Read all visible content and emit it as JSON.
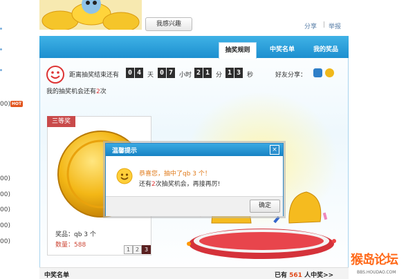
{
  "left_column": {
    "values": [
      "00)",
      "00)",
      "00)",
      "00)",
      "00)",
      "00)"
    ],
    "hot_badge": "HOT"
  },
  "top": {
    "interest_button": "我感兴趣",
    "share_link": "分享",
    "separator": "|",
    "report_link": "举报"
  },
  "tabs": [
    {
      "label": "抽奖规则"
    },
    {
      "label": "中奖名单"
    },
    {
      "label": "我的奖品"
    }
  ],
  "countdown": {
    "prefix": "距离抽奖结束还有",
    "days": [
      "0",
      "4"
    ],
    "day_unit": "天",
    "hours": [
      "0",
      "7"
    ],
    "hour_unit": "小时",
    "minutes": [
      "2",
      "1"
    ],
    "minute_unit": "分",
    "seconds": [
      "1",
      "3"
    ],
    "second_unit": "秒"
  },
  "friend_share_label": "好友分享：",
  "chances": {
    "prefix": "我的抽奖机会还有",
    "count": "2",
    "suffix": "次"
  },
  "prize_card": {
    "tag": "三等奖",
    "name": "奖品：qb 3 个",
    "quantity": "数量：588",
    "pages": [
      "1",
      "2",
      "3"
    ],
    "current_page": "3"
  },
  "dialog": {
    "title": "温馨提示",
    "close": "×",
    "message1": "恭喜您，抽中了qb 3 个！",
    "message2_prefix": "还有",
    "message2_count": "2",
    "message2_suffix": "次抽奖机会，再接再厉!",
    "ok_button": "确定"
  },
  "bottom": {
    "winners_title": "中奖名单",
    "count_prefix": "已有",
    "count": "561",
    "count_suffix": "人中奖>>"
  },
  "watermark": {
    "text": "猴岛论坛",
    "sub": "BBS.HOUDAO.COM"
  },
  "colors": {
    "accent_blue": "#1d8fcf",
    "tab_bar": "#3fb2e6",
    "prize_red": "#c94a4a",
    "digit_box": "#2e2e2e",
    "highlight_orange": "#e07a1a"
  }
}
